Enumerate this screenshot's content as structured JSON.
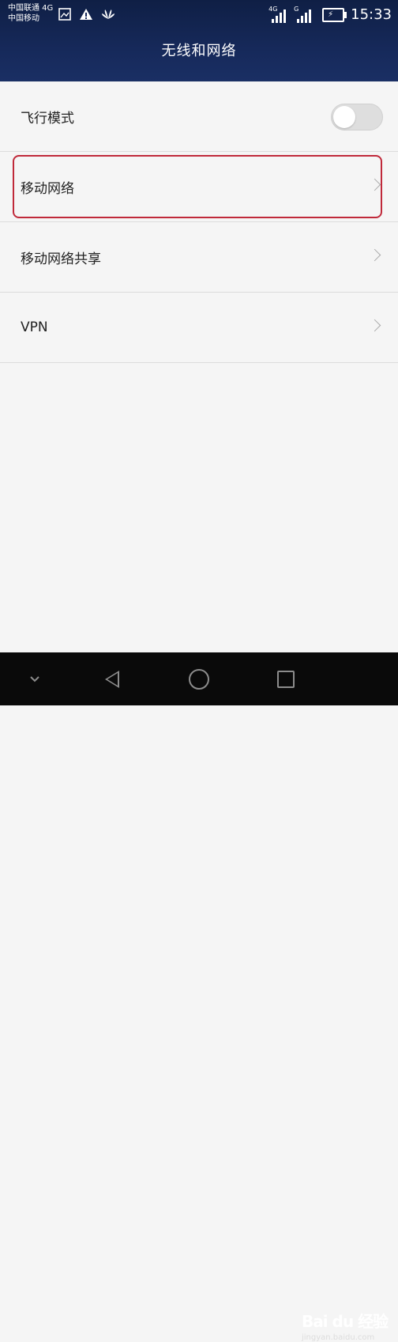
{
  "status_bar": {
    "carrier1": "中国联通 4G",
    "carrier2": "中国移动",
    "icons_left": [
      "gallery-icon",
      "warning-icon",
      "huawei-icon"
    ],
    "signal1_net": "4G",
    "signal2_net": "G",
    "time": "15:33"
  },
  "header": {
    "title": "无线和网络"
  },
  "list": {
    "items": [
      {
        "label": "飞行模式",
        "control": "toggle",
        "toggle_on": false
      },
      {
        "label": "移动网络",
        "control": "chevron",
        "highlighted": true
      },
      {
        "label": "移动网络共享",
        "control": "chevron"
      },
      {
        "label": "VPN",
        "control": "chevron"
      }
    ]
  },
  "navbar": {
    "buttons": [
      "hide-nav-icon",
      "back-icon",
      "home-icon",
      "recent-apps-icon"
    ]
  },
  "watermark": {
    "main": "Bai du 经验",
    "sub": "jingyan.baidu.com"
  },
  "colors": {
    "header_bg": "#16295a",
    "highlight_border": "#c0293a",
    "navbar_bg": "#0a0a0a"
  }
}
